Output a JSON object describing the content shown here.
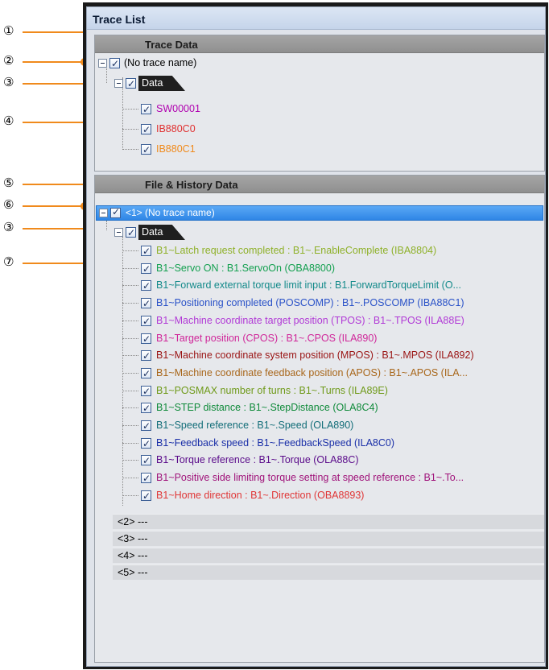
{
  "window": {
    "title": "Trace List"
  },
  "trace_data": {
    "header": "Trace Data",
    "trace_name": "(No trace name)",
    "data_tab": "Data",
    "items": [
      {
        "label": "SW00001",
        "color": "#b000b0"
      },
      {
        "label": "IB880C0",
        "color": "#e03030"
      },
      {
        "label": "IB880C1",
        "color": "#f08a1c"
      }
    ]
  },
  "file_history": {
    "header": "File & History Data",
    "selected_trace": "<1> (No trace name)",
    "data_tab": "Data",
    "items": [
      {
        "label": "B1~Latch request completed : B1~.EnableComplete (IBA8804)",
        "color": "#8fb12a"
      },
      {
        "label": "B1~Servo ON : B1.ServoOn (OBA8800)",
        "color": "#14a050"
      },
      {
        "label": "B1~Forward external torque limit input : B1.ForwardTorqueLimit (O...",
        "color": "#138a8a"
      },
      {
        "label": "B1~Positioning completed (POSCOMP) : B1~.POSCOMP (IBA88C1)",
        "color": "#2a52c8"
      },
      {
        "label": "B1~Machine coordinate target position (TPOS) : B1~.TPOS (ILA88E)",
        "color": "#b13ad6"
      },
      {
        "label": "B1~Target position (CPOS) : B1~.CPOS (ILA890)",
        "color": "#d0279a"
      },
      {
        "label": "B1~Machine coordinate system position (MPOS) : B1~.MPOS (ILA892)",
        "color": "#9a1414"
      },
      {
        "label": "B1~Machine coordinate feedback position (APOS) : B1~.APOS (ILA...",
        "color": "#a8661a"
      },
      {
        "label": "B1~POSMAX number of turns : B1~.Turns (ILA89E)",
        "color": "#6f9a1a"
      },
      {
        "label": "B1~STEP distance : B1~.StepDistance (OLA8C4)",
        "color": "#0f8a3a"
      },
      {
        "label": "B1~Speed reference : B1~.Speed (OLA890)",
        "color": "#126d78"
      },
      {
        "label": "B1~Feedback speed : B1~.FeedbackSpeed (ILA8C0)",
        "color": "#1a2fa8"
      },
      {
        "label": "B1~Torque reference : B1~.Torque (OLA88C)",
        "color": "#5a0a8a"
      },
      {
        "label": "B1~Positive side limiting torque setting at speed reference : B1~.To...",
        "color": "#a0137a"
      },
      {
        "label": "B1~Home direction : B1~.Direction (OBA8893)",
        "color": "#e03636"
      }
    ],
    "other_traces": [
      "<2> ---",
      "<3> ---",
      "<4> ---",
      "<5> ---"
    ]
  },
  "callouts": [
    "①",
    "②",
    "③",
    "④",
    "⑤",
    "⑥",
    "③",
    "⑦"
  ],
  "accent_color": "#f08a1c",
  "selection_color": "#3b8fea"
}
